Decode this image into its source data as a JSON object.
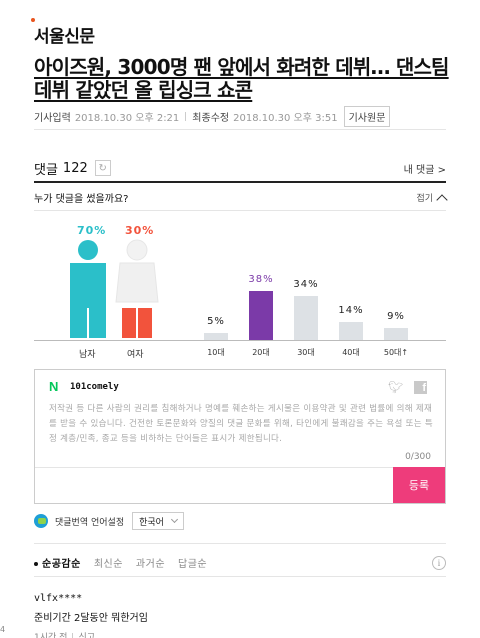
{
  "publisher": {
    "name": "서울신문"
  },
  "article": {
    "headline": "아이즈원, 3000명 팬 앞에서 화려한 데뷔… 댄스팀 데뷔 같았던 올 립싱크 쇼콘",
    "published_label": "기사입력",
    "published": "2018.10.30 오후 2:21",
    "modified_label": "최종수정",
    "modified": "2018.10.30 오후 3:51",
    "original_button": "기사원문"
  },
  "comments_header": {
    "title": "댓글",
    "count": "122",
    "my_comments": "내 댓글 >"
  },
  "who_wrote": {
    "question": "누가 댓글을 썼을까요?",
    "collapse_label": "접기"
  },
  "gender_stats": {
    "male": {
      "label": "남자",
      "percent": "70%",
      "color": "#2bbfc9"
    },
    "female": {
      "label": "여자",
      "percent": "30%",
      "color": "#f2533c"
    }
  },
  "chart_data": {
    "type": "bar",
    "categories": [
      "10대",
      "20대",
      "30대",
      "40대",
      "50대↑"
    ],
    "values": [
      5,
      38,
      34,
      14,
      9
    ],
    "value_labels": [
      "5%",
      "38%",
      "34%",
      "14%",
      "9%"
    ],
    "highlight_index": 1,
    "highlight_color": "#7b3aa8",
    "bar_color": "#dde1e5",
    "ylim": [
      0,
      40
    ]
  },
  "write_box": {
    "username": "101comely",
    "placeholder": "저작권 등 다른 사람의 권리를 침해하거나 명예를 훼손하는 게시물은 이용약관 및 관련 법률에 의해 제재를 받을 수 있습니다. 건전한 토론문화와 양질의 댓글 문화를 위해, 타인에게 불쾌감을 주는 욕설 또는 특정 계층/민족, 종교 등을 비하하는 단어들은 표시가 제한됩니다.",
    "char_count": "0/300",
    "submit_label": "등록"
  },
  "translate": {
    "label": "댓글번역 언어설정",
    "language": "한국어"
  },
  "sort_tabs": [
    "순공감순",
    "최신순",
    "과거순",
    "답글순"
  ],
  "comments": [
    {
      "user": "vlfx****",
      "text": "준비기간 2달동안 뭐한거임",
      "time": "1시간 전",
      "report": "신고"
    }
  ],
  "edge_number": "4"
}
